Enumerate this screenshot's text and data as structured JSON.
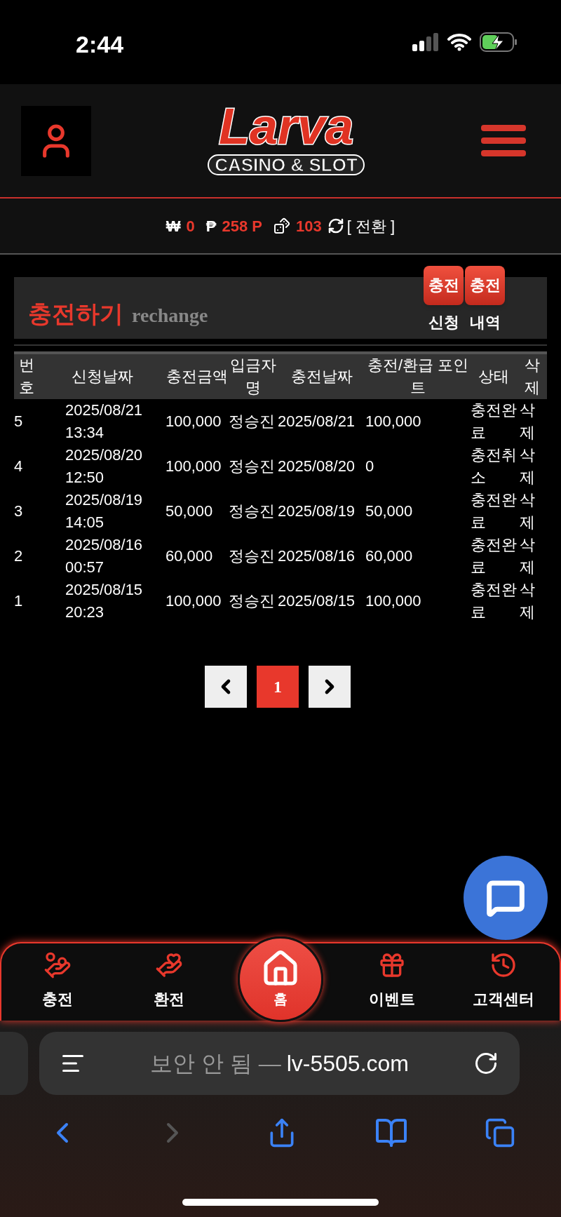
{
  "status_bar": {
    "time": "2:44"
  },
  "header": {
    "logo_title": "Larva",
    "logo_subtitle": "CASINO & SLOT"
  },
  "balance": [
    {
      "symbol": "₩",
      "value": "0"
    },
    {
      "symbol": "₱",
      "value": "258 P"
    },
    {
      "value": "103",
      "kind": "dice"
    }
  ],
  "convert_label": "[ 전환 ]",
  "section": {
    "title": "충전하기",
    "subtitle": "rechange",
    "buttons": [
      {
        "label": "충전",
        "caption": "신청"
      },
      {
        "label": "충전",
        "caption": "내역"
      }
    ]
  },
  "table": {
    "columns": [
      "번호",
      "신청날짜",
      "충전금액",
      "입금자명",
      "충전날짜",
      "충전/환급 포인트",
      "상태",
      "삭제"
    ],
    "rows": [
      [
        "5",
        "2025/08/21 13:34",
        "100,000",
        "정승진",
        "2025/08/21",
        "100,000",
        "충전완료",
        "삭제"
      ],
      [
        "4",
        "2025/08/20 12:50",
        "100,000",
        "정승진",
        "2025/08/20",
        "0",
        "충전취소",
        "삭제"
      ],
      [
        "3",
        "2025/08/19 14:05",
        "50,000",
        "정승진",
        "2025/08/19",
        "50,000",
        "충전완료",
        "삭제"
      ],
      [
        "2",
        "2025/08/16 00:57",
        "60,000",
        "정승진",
        "2025/08/16",
        "60,000",
        "충전완료",
        "삭제"
      ],
      [
        "1",
        "2025/08/15 20:23",
        "100,000",
        "정승진",
        "2025/08/15",
        "100,000",
        "충전완료",
        "삭제"
      ]
    ]
  },
  "pagination": {
    "pages": [
      {
        "label": "1",
        "selected": true
      }
    ]
  },
  "bottom_nav": [
    {
      "label": "충전",
      "kind": "deposit"
    },
    {
      "label": "환전",
      "kind": "withdraw"
    },
    {
      "label": "홈",
      "kind": "home"
    },
    {
      "label": "이벤트",
      "kind": "event"
    },
    {
      "label": "고객센터",
      "kind": "support"
    }
  ],
  "browser": {
    "security": "보안 안 됨 —",
    "domain": "lv-5505.com"
  }
}
